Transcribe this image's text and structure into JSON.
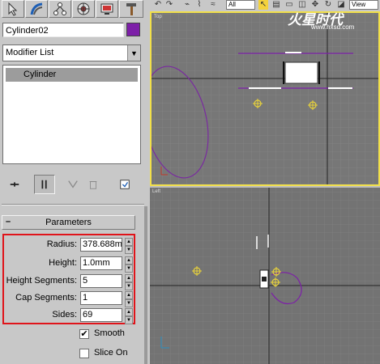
{
  "object": {
    "name": "Cylinder02",
    "color": "#7d1fa8"
  },
  "modifier_list": {
    "label": "Modifier List"
  },
  "stack": {
    "items": [
      "Cylinder"
    ]
  },
  "parameters": {
    "title": "Parameters",
    "collapse": "–",
    "fields": [
      {
        "label": "Radius:",
        "value": "378.688m"
      },
      {
        "label": "Height:",
        "value": "1.0mm"
      },
      {
        "label": "Height Segments:",
        "value": "5"
      },
      {
        "label": "Cap Segments:",
        "value": "1"
      },
      {
        "label": "Sides:",
        "value": "69"
      }
    ],
    "smooth": {
      "label": "Smooth",
      "checked": true,
      "mark": "✔"
    },
    "slice_on": {
      "label": "Slice On",
      "checked": false
    }
  },
  "toolbar": {
    "dropdown": "All",
    "view": "View"
  },
  "viewports": {
    "top_label": "Top",
    "left_label": "Left"
  },
  "watermark": {
    "main": "火星时代",
    "url": "www.hxsd.com"
  },
  "colors": {
    "highlight_border": "#f2e04a",
    "red_box": "#e0141a",
    "object_color": "#7d1fa8",
    "selected": "#ffffff"
  }
}
